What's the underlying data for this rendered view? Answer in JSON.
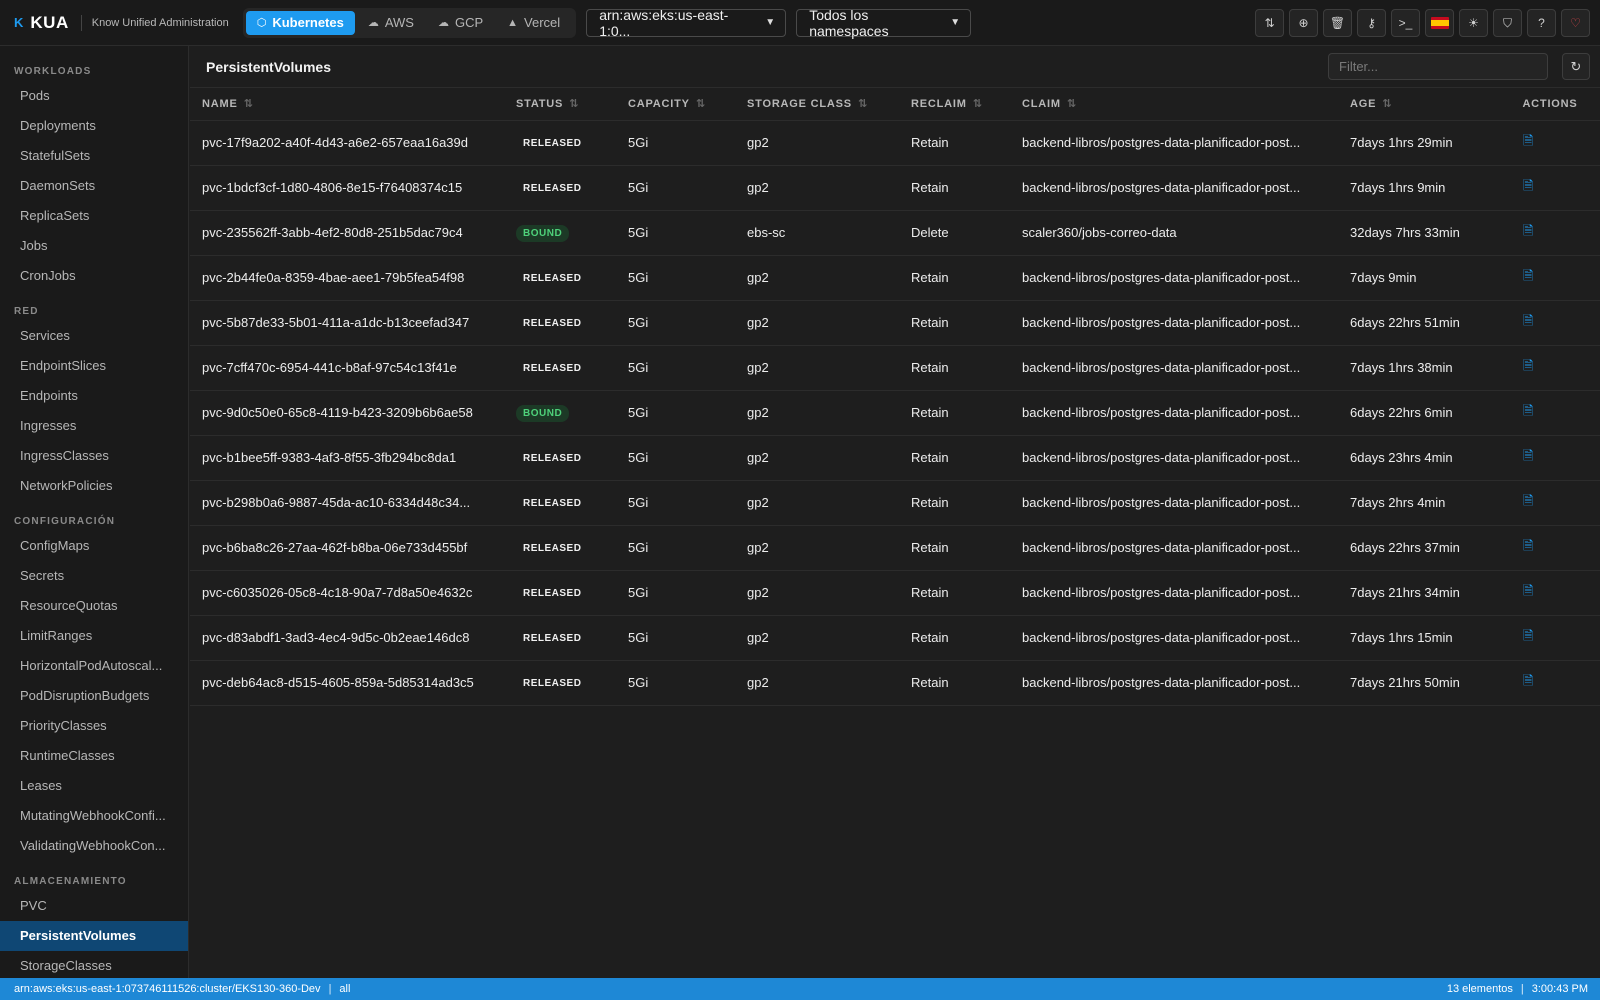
{
  "app": {
    "logo_mark": "K",
    "name": "KUA",
    "subtitle": "Know Unified Administration"
  },
  "providers": [
    {
      "label": "Kubernetes",
      "icon": "cube-icon",
      "active": true
    },
    {
      "label": "AWS",
      "icon": "cloud-icon",
      "active": false
    },
    {
      "label": "GCP",
      "icon": "cloud-upload-icon",
      "active": false
    },
    {
      "label": "Vercel",
      "icon": "triangle-icon",
      "active": false
    }
  ],
  "cluster_select": {
    "value": "arn:aws:eks:us-east-1:0..."
  },
  "namespace_select": {
    "value": "Todos los namespaces"
  },
  "toolbar_icons": [
    "sort-icon",
    "plus-circle-icon",
    "trash-icon",
    "key-icon",
    "terminal-icon",
    "flag-es-icon",
    "sun-icon",
    "shield-icon",
    "help-icon",
    "heart-icon"
  ],
  "sidebar": {
    "sections": [
      {
        "title": "WORKLOADS",
        "items": [
          "Pods",
          "Deployments",
          "StatefulSets",
          "DaemonSets",
          "ReplicaSets",
          "Jobs",
          "CronJobs"
        ]
      },
      {
        "title": "RED",
        "items": [
          "Services",
          "EndpointSlices",
          "Endpoints",
          "Ingresses",
          "IngressClasses",
          "NetworkPolicies"
        ]
      },
      {
        "title": "CONFIGURACIÓN",
        "items": [
          "ConfigMaps",
          "Secrets",
          "ResourceQuotas",
          "LimitRanges",
          "HorizontalPodAutoscal...",
          "PodDisruptionBudgets",
          "PriorityClasses",
          "RuntimeClasses",
          "Leases",
          "MutatingWebhookConfi...",
          "ValidatingWebhookCon..."
        ]
      },
      {
        "title": "ALMACENAMIENTO",
        "items": [
          "PVC",
          "PersistentVolumes",
          "StorageClasses"
        ]
      }
    ],
    "active_item": "PersistentVolumes"
  },
  "main": {
    "title": "PersistentVolumes",
    "filter_placeholder": "Filter...",
    "columns": [
      "NAME",
      "STATUS",
      "CAPACITY",
      "STORAGE CLASS",
      "RECLAIM",
      "CLAIM",
      "AGE",
      "ACTIONS"
    ],
    "rows": [
      {
        "name": "pvc-17f9a202-a40f-4d43-a6e2-657eaa16a39d",
        "status": "RELEASED",
        "capacity": "5Gi",
        "storage_class": "gp2",
        "reclaim": "Retain",
        "claim": "backend-libros/postgres-data-planificador-post...",
        "age": "7days 1hrs 29min"
      },
      {
        "name": "pvc-1bdcf3cf-1d80-4806-8e15-f76408374c15",
        "status": "RELEASED",
        "capacity": "5Gi",
        "storage_class": "gp2",
        "reclaim": "Retain",
        "claim": "backend-libros/postgres-data-planificador-post...",
        "age": "7days 1hrs 9min"
      },
      {
        "name": "pvc-235562ff-3abb-4ef2-80d8-251b5dac79c4",
        "status": "BOUND",
        "capacity": "5Gi",
        "storage_class": "ebs-sc",
        "reclaim": "Delete",
        "claim": "scaler360/jobs-correo-data",
        "age": "32days 7hrs 33min"
      },
      {
        "name": "pvc-2b44fe0a-8359-4bae-aee1-79b5fea54f98",
        "status": "RELEASED",
        "capacity": "5Gi",
        "storage_class": "gp2",
        "reclaim": "Retain",
        "claim": "backend-libros/postgres-data-planificador-post...",
        "age": "7days 9min"
      },
      {
        "name": "pvc-5b87de33-5b01-411a-a1dc-b13ceefad347",
        "status": "RELEASED",
        "capacity": "5Gi",
        "storage_class": "gp2",
        "reclaim": "Retain",
        "claim": "backend-libros/postgres-data-planificador-post...",
        "age": "6days 22hrs 51min"
      },
      {
        "name": "pvc-7cff470c-6954-441c-b8af-97c54c13f41e",
        "status": "RELEASED",
        "capacity": "5Gi",
        "storage_class": "gp2",
        "reclaim": "Retain",
        "claim": "backend-libros/postgres-data-planificador-post...",
        "age": "7days 1hrs 38min"
      },
      {
        "name": "pvc-9d0c50e0-65c8-4119-b423-3209b6b6ae58",
        "status": "BOUND",
        "capacity": "5Gi",
        "storage_class": "gp2",
        "reclaim": "Retain",
        "claim": "backend-libros/postgres-data-planificador-post...",
        "age": "6days 22hrs 6min"
      },
      {
        "name": "pvc-b1bee5ff-9383-4af3-8f55-3fb294bc8da1",
        "status": "RELEASED",
        "capacity": "5Gi",
        "storage_class": "gp2",
        "reclaim": "Retain",
        "claim": "backend-libros/postgres-data-planificador-post...",
        "age": "6days 23hrs 4min"
      },
      {
        "name": "pvc-b298b0a6-9887-45da-ac10-6334d48c34...",
        "status": "RELEASED",
        "capacity": "5Gi",
        "storage_class": "gp2",
        "reclaim": "Retain",
        "claim": "backend-libros/postgres-data-planificador-post...",
        "age": "7days 2hrs 4min"
      },
      {
        "name": "pvc-b6ba8c26-27aa-462f-b8ba-06e733d455bf",
        "status": "RELEASED",
        "capacity": "5Gi",
        "storage_class": "gp2",
        "reclaim": "Retain",
        "claim": "backend-libros/postgres-data-planificador-post...",
        "age": "6days 22hrs 37min"
      },
      {
        "name": "pvc-c6035026-05c8-4c18-90a7-7d8a50e4632c",
        "status": "RELEASED",
        "capacity": "5Gi",
        "storage_class": "gp2",
        "reclaim": "Retain",
        "claim": "backend-libros/postgres-data-planificador-post...",
        "age": "7days 21hrs 34min"
      },
      {
        "name": "pvc-d83abdf1-3ad3-4ec4-9d5c-0b2eae146dc8",
        "status": "RELEASED",
        "capacity": "5Gi",
        "storage_class": "gp2",
        "reclaim": "Retain",
        "claim": "backend-libros/postgres-data-planificador-post...",
        "age": "7days 1hrs 15min"
      },
      {
        "name": "pvc-deb64ac8-d515-4605-859a-5d85314ad3c5",
        "status": "RELEASED",
        "capacity": "5Gi",
        "storage_class": "gp2",
        "reclaim": "Retain",
        "claim": "backend-libros/postgres-data-planificador-post...",
        "age": "7days 21hrs 50min"
      }
    ]
  },
  "statusbar": {
    "cluster": "arn:aws:eks:us-east-1:073746111526:cluster/EKS130-360-Dev",
    "namespace": "all",
    "count": "13 elementos",
    "time": "3:00:43 PM"
  },
  "colors": {
    "accent": "#1e9bf0",
    "active_nav": "#0f4774",
    "bound": "#4ed17a",
    "statusbar": "#1e88d6",
    "heart": "#e5484d"
  }
}
